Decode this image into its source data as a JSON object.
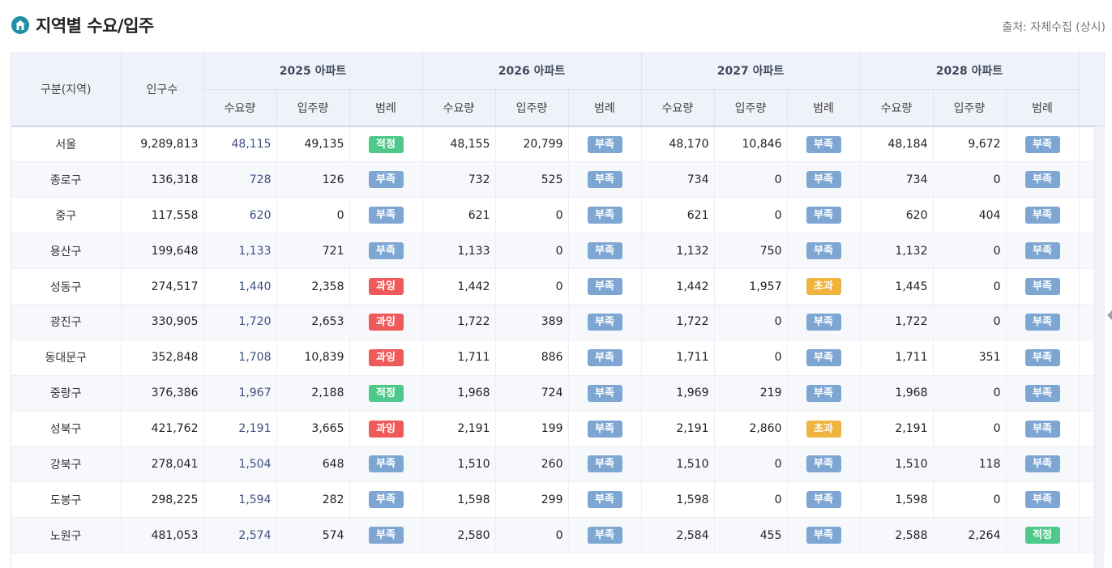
{
  "header": {
    "title": "지역별 수요/입주",
    "source": "출처: 자체수집 (상시)"
  },
  "table": {
    "col_region": "구분(지역)",
    "col_population": "인구수",
    "years": [
      "2025 아파트",
      "2026 아파트",
      "2027 아파트",
      "2028 아파트"
    ],
    "sub_demand": "수요량",
    "sub_supply": "입주량",
    "sub_legend": "범례",
    "rows": [
      {
        "region": "서울",
        "population": "9,289,813",
        "y2025": {
          "demand": "48,115",
          "supply": "49,135",
          "status": "적정"
        },
        "y2026": {
          "demand": "48,155",
          "supply": "20,799",
          "status": "부족"
        },
        "y2027": {
          "demand": "48,170",
          "supply": "10,846",
          "status": "부족"
        },
        "y2028": {
          "demand": "48,184",
          "supply": "9,672",
          "status": "부족"
        }
      },
      {
        "region": "종로구",
        "population": "136,318",
        "y2025": {
          "demand": "728",
          "supply": "126",
          "status": "부족"
        },
        "y2026": {
          "demand": "732",
          "supply": "525",
          "status": "부족"
        },
        "y2027": {
          "demand": "734",
          "supply": "0",
          "status": "부족"
        },
        "y2028": {
          "demand": "734",
          "supply": "0",
          "status": "부족"
        }
      },
      {
        "region": "중구",
        "population": "117,558",
        "y2025": {
          "demand": "620",
          "supply": "0",
          "status": "부족"
        },
        "y2026": {
          "demand": "621",
          "supply": "0",
          "status": "부족"
        },
        "y2027": {
          "demand": "621",
          "supply": "0",
          "status": "부족"
        },
        "y2028": {
          "demand": "620",
          "supply": "404",
          "status": "부족"
        }
      },
      {
        "region": "용산구",
        "population": "199,648",
        "y2025": {
          "demand": "1,133",
          "supply": "721",
          "status": "부족"
        },
        "y2026": {
          "demand": "1,133",
          "supply": "0",
          "status": "부족"
        },
        "y2027": {
          "demand": "1,132",
          "supply": "750",
          "status": "부족"
        },
        "y2028": {
          "demand": "1,132",
          "supply": "0",
          "status": "부족"
        }
      },
      {
        "region": "성동구",
        "population": "274,517",
        "y2025": {
          "demand": "1,440",
          "supply": "2,358",
          "status": "과잉"
        },
        "y2026": {
          "demand": "1,442",
          "supply": "0",
          "status": "부족"
        },
        "y2027": {
          "demand": "1,442",
          "supply": "1,957",
          "status": "초과"
        },
        "y2028": {
          "demand": "1,445",
          "supply": "0",
          "status": "부족"
        }
      },
      {
        "region": "광진구",
        "population": "330,905",
        "y2025": {
          "demand": "1,720",
          "supply": "2,653",
          "status": "과잉"
        },
        "y2026": {
          "demand": "1,722",
          "supply": "389",
          "status": "부족"
        },
        "y2027": {
          "demand": "1,722",
          "supply": "0",
          "status": "부족"
        },
        "y2028": {
          "demand": "1,722",
          "supply": "0",
          "status": "부족"
        }
      },
      {
        "region": "동대문구",
        "population": "352,848",
        "y2025": {
          "demand": "1,708",
          "supply": "10,839",
          "status": "과잉"
        },
        "y2026": {
          "demand": "1,711",
          "supply": "886",
          "status": "부족"
        },
        "y2027": {
          "demand": "1,711",
          "supply": "0",
          "status": "부족"
        },
        "y2028": {
          "demand": "1,711",
          "supply": "351",
          "status": "부족"
        }
      },
      {
        "region": "중랑구",
        "population": "376,386",
        "y2025": {
          "demand": "1,967",
          "supply": "2,188",
          "status": "적정"
        },
        "y2026": {
          "demand": "1,968",
          "supply": "724",
          "status": "부족"
        },
        "y2027": {
          "demand": "1,969",
          "supply": "219",
          "status": "부족"
        },
        "y2028": {
          "demand": "1,968",
          "supply": "0",
          "status": "부족"
        }
      },
      {
        "region": "성북구",
        "population": "421,762",
        "y2025": {
          "demand": "2,191",
          "supply": "3,665",
          "status": "과잉"
        },
        "y2026": {
          "demand": "2,191",
          "supply": "199",
          "status": "부족"
        },
        "y2027": {
          "demand": "2,191",
          "supply": "2,860",
          "status": "초과"
        },
        "y2028": {
          "demand": "2,191",
          "supply": "0",
          "status": "부족"
        }
      },
      {
        "region": "강북구",
        "population": "278,041",
        "y2025": {
          "demand": "1,504",
          "supply": "648",
          "status": "부족"
        },
        "y2026": {
          "demand": "1,510",
          "supply": "260",
          "status": "부족"
        },
        "y2027": {
          "demand": "1,510",
          "supply": "0",
          "status": "부족"
        },
        "y2028": {
          "demand": "1,510",
          "supply": "118",
          "status": "부족"
        }
      },
      {
        "region": "도봉구",
        "population": "298,225",
        "y2025": {
          "demand": "1,594",
          "supply": "282",
          "status": "부족"
        },
        "y2026": {
          "demand": "1,598",
          "supply": "299",
          "status": "부족"
        },
        "y2027": {
          "demand": "1,598",
          "supply": "0",
          "status": "부족"
        },
        "y2028": {
          "demand": "1,598",
          "supply": "0",
          "status": "부족"
        }
      },
      {
        "region": "노원구",
        "population": "481,053",
        "y2025": {
          "demand": "2,574",
          "supply": "574",
          "status": "부족"
        },
        "y2026": {
          "demand": "2,580",
          "supply": "0",
          "status": "부족"
        },
        "y2027": {
          "demand": "2,584",
          "supply": "455",
          "status": "부족"
        },
        "y2028": {
          "demand": "2,588",
          "supply": "2,264",
          "status": "적정"
        }
      }
    ]
  },
  "legend_colors": {
    "부족": "#7ea6d3",
    "과잉": "#ee5a5a",
    "적정": "#4fc98a",
    "초과": "#efb33e"
  }
}
